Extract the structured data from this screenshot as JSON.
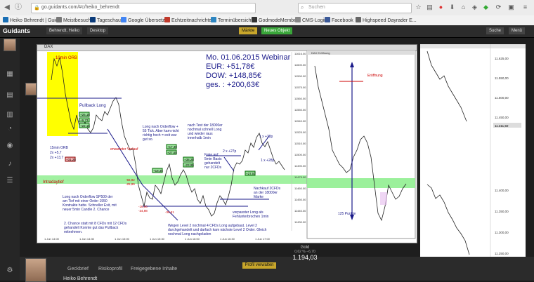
{
  "browser": {
    "url": "go.guidants.com/#c/heiko_behrendt",
    "search_placeholder": "Suchen"
  },
  "bookmarks": [
    {
      "label": "Heiko Behrendt | Guid...",
      "color": "#1a6fb5"
    },
    {
      "label": "Meistbesucht",
      "color": "#777"
    },
    {
      "label": "Tageschau",
      "color": "#0b3b7a"
    },
    {
      "label": "Google Übersetzer",
      "color": "#4285f4"
    },
    {
      "label": "Echtzeitnachrichten",
      "color": "#c0392b"
    },
    {
      "label": "Terminübersicht",
      "color": "#2e86c1"
    },
    {
      "label": "GodmodeMembers",
      "color": "#333"
    },
    {
      "label": "CMS-Login",
      "color": "#888"
    },
    {
      "label": "Facebook",
      "color": "#3b5998"
    },
    {
      "label": "Highspeed Dayrader E...",
      "color": "#666"
    }
  ],
  "app": {
    "logo": "Guidants",
    "tabs": [
      "Behrendt, Heiko",
      "Desktop"
    ],
    "btn_market": "Märkte",
    "btn_new": "Neues Objekt",
    "btn_search": "Suche",
    "btn_menu": "Menü",
    "colors": {
      "accent": "#c8a62b",
      "green": "#3aa63a"
    }
  },
  "sidebar_icons": [
    "monitor-icon",
    "calendar-icon",
    "news-icon",
    "gauge-icon",
    "chart-icon",
    "user-icon",
    "settings-icon"
  ],
  "main_window": {
    "title": "DAX",
    "headline": "Mo. 01.06.2015 Webinar",
    "eur": "EUR: +51,78€",
    "dow": "DOW: +148,85€",
    "total": "ges. : +200,63€",
    "labels": {
      "orb10": "10min ORB",
      "pullback": "Pullback Long",
      "orb15": "15min ORB\n2x +5,7\n2x +13,7",
      "erwartet": "erwarteter Verlauf",
      "long_orderflow": "Long nach Orderflow + 55 Tick. Aber kam nicht richtig hoch = exit war gut so.",
      "nach_test": "nach Test der 18000er nochmal schnell Long und wieder raus innerhalb 1min",
      "fake": "Fake auf 5min Basis gehandelt nur 2CFDs",
      "intradaytief": "Intradaytief",
      "long_sp500": "Long nach Orderflow SP500 der am Tief mit einer Order 1950 Kontrakte hatte. Schneller Exit, mit neuer 5min Candle 2. Chance",
      "chance2": "2. Chance statt mit 8 CFDs mit 12 CFDs gehandelt Konnte gut das Pullback mitnehmen.",
      "wegen_level": "Wegen Level 2 nochmal 4 CFDs Long aufgebaut. Level 2 durchgehandelt und darfach kam nächste Level 2 Order. Gleich nochmal Long nachgeladen",
      "verpasster": "verpasster Long als Fehlunterbrochen 1min",
      "nachkauf": "Nachkauf 2CFDs an der 18000er Marke",
      "two_x_27": "2 x +27p",
      "one_x_38": "1 x +38p",
      "one_x_28": "1 x +28p"
    },
    "badges": [
      "+26,16",
      "+9,73",
      "+22,15",
      "+17,30",
      "+27,55",
      "+38,28",
      "+23,95",
      "+18,35",
      "-16,66",
      "-34,98",
      "-36,51",
      "-25,89",
      "-56,92",
      "-16,66",
      "+27,57",
      "+31,25"
    ],
    "price_axis": [
      "11616.00",
      "11600.00",
      "11590.00",
      "11575.00",
      "11560.00",
      "11550.00",
      "11540.00",
      "11525.00",
      "11510.00",
      "11500.00",
      "11490.00",
      "11475.00",
      "11460.00",
      "11450.00",
      "11440.00",
      "11430.00"
    ],
    "time_axis": [
      "1 Jun 14:00",
      "1 Jun 14:30",
      "1 Jun 15:00",
      "1 Jun 15:30",
      "1 Jun 16:00",
      "1 Jun 16:30",
      "1 Jun 17:00"
    ]
  },
  "inner_chart": {
    "title": "DAX Eröffnung",
    "label_open": "Eröffnung",
    "label_points": "125 Punkte"
  },
  "right_chart": {
    "price_labels": [
      "11.625,00",
      "11.550,00",
      "11.500,00",
      "11.450,00",
      "11.400,00",
      "11.350,00",
      "11.300,00",
      "11.250,00"
    ],
    "highlight": "11.311,50"
  },
  "bottom": {
    "tabs": [
      "Geckbrief",
      "Risikoprofil",
      "Freigegebene Inhalte"
    ],
    "gold_label": "Gold",
    "gold_price": "1.194,03",
    "gold_change": "0,62 %  −6,70",
    "orange_btn": "Profil verwalten",
    "user_name": "Heiko Behrendt"
  }
}
